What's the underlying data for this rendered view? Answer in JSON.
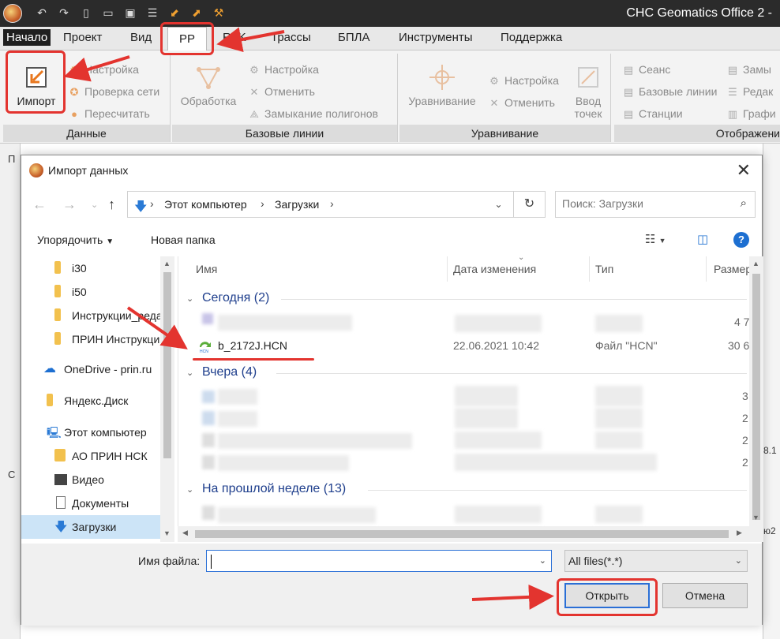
{
  "app": {
    "title": "CHC Geomatics Office 2 -"
  },
  "menu": {
    "tabs": [
      {
        "label": "Начало"
      },
      {
        "label": "Проект"
      },
      {
        "label": "Вид"
      },
      {
        "label": "PP"
      },
      {
        "label": "RTK"
      },
      {
        "label": "Трассы"
      },
      {
        "label": "БПЛА"
      },
      {
        "label": "Инструменты"
      },
      {
        "label": "Поддержка"
      }
    ]
  },
  "ribbon": {
    "data_group": {
      "title": "Данные",
      "import": "Импорт",
      "settings": "Настройка",
      "check_network": "Проверка сети",
      "recalc": "Пересчитать"
    },
    "baselines_group": {
      "title": "Базовые линии",
      "processing": "Обработка",
      "settings": "Настройка",
      "cancel": "Отменить",
      "loop_closure": "Замыкание полигонов"
    },
    "adjust_group": {
      "title": "Уравнивание",
      "adjust": "Уравнивание",
      "settings": "Настройка",
      "cancel": "Отменить",
      "input_points_1": "Ввод",
      "input_points_2": "точек"
    },
    "display_group": {
      "title": "Отображени",
      "session": "Сеанс",
      "baselines": "Базовые линии",
      "stations": "Станции",
      "col2_1": "Замы",
      "col2_2": "Редак",
      "col2_3": "Графи"
    }
  },
  "left_pane": {
    "tab1": "П",
    "tab2": "С"
  },
  "right_pane": {
    "text1": "8.1",
    "text2": "ю2"
  },
  "dialog": {
    "title": "Импорт данных",
    "breadcrumbs": [
      "Этот компьютер",
      "Загрузки"
    ],
    "search_placeholder": "Поиск: Загрузки",
    "toolbar": {
      "organize": "Упорядочить",
      "new_folder": "Новая папка"
    },
    "nav_items": [
      {
        "label": "i30",
        "icon": "folder"
      },
      {
        "label": "i50",
        "icon": "folder"
      },
      {
        "label": "Инструкции_реда",
        "icon": "folder"
      },
      {
        "label": "ПРИН Инструкци",
        "icon": "folder"
      },
      {
        "label": "OneDrive - prin.ru",
        "icon": "onedrive"
      },
      {
        "label": "Яндекс.Диск",
        "icon": "folder"
      },
      {
        "label": "Этот компьютер",
        "icon": "computer"
      },
      {
        "label": "АО ПРИН НСК",
        "icon": "user-folder"
      },
      {
        "label": "Видео",
        "icon": "video"
      },
      {
        "label": "Документы",
        "icon": "documents"
      },
      {
        "label": "Загрузки",
        "icon": "downloads",
        "selected": true
      }
    ],
    "columns": {
      "name": "Имя",
      "date": "Дата изменения",
      "type": "Тип",
      "size": "Размер"
    },
    "groups": {
      "today": "Сегодня (2)",
      "yesterday": "Вчера (4)",
      "last_week": "На прошлой неделе (13)"
    },
    "files": {
      "blurred_size": "4 7",
      "hcn": {
        "name": "b_2172J.HCN",
        "date": "22.06.2021 10:42",
        "type": "Файл \"HCN\"",
        "size": "30 6"
      }
    },
    "yesterday_sizes": [
      "3",
      "2",
      "2",
      "2"
    ],
    "filename_label": "Имя файла:",
    "filename_value": "",
    "filetype": "All files(*.*)",
    "open_button": "Открыть",
    "cancel_button": "Отмена"
  },
  "colors": {
    "annotation_red": "#e3342f",
    "selection_blue": "#cce4f7",
    "group_header_blue": "#1e3e8c",
    "focus_blue": "#2a6fd6"
  }
}
